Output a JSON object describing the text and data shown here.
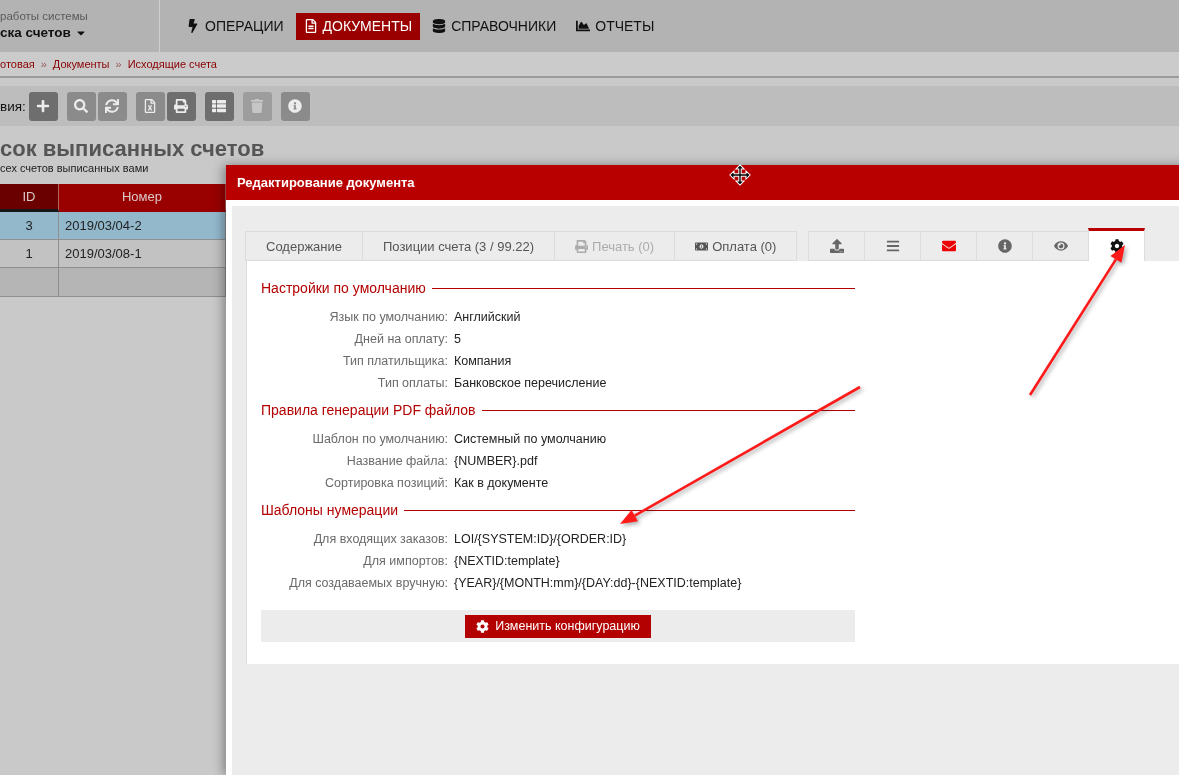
{
  "header": {
    "caption": "работы системы",
    "account": "ска счетов",
    "nav": [
      {
        "label": "ОПЕРАЦИИ",
        "kind": "operations",
        "selected": false
      },
      {
        "label": "ДОКУМЕНТЫ",
        "kind": "documents",
        "selected": true
      },
      {
        "label": "СПРАВОЧНИКИ",
        "kind": "directories",
        "selected": false
      },
      {
        "label": "ОТЧЕТЫ",
        "kind": "reports",
        "selected": false
      }
    ]
  },
  "breadcrumbs": {
    "separator": "»",
    "items": [
      "отовая",
      "Документы",
      "Исходящие счета"
    ]
  },
  "toolbar": {
    "label": "вия:",
    "groups": [
      [
        {
          "kind": "add",
          "disabled": false
        }
      ],
      [
        {
          "kind": "search",
          "disabled": false
        },
        {
          "kind": "refresh",
          "disabled": false
        }
      ],
      [
        {
          "kind": "excel",
          "disabled": false
        },
        {
          "kind": "print",
          "disabled": false
        }
      ],
      [
        {
          "kind": "list",
          "disabled": false
        }
      ],
      [
        {
          "kind": "delete",
          "disabled": true
        }
      ],
      [
        {
          "kind": "info",
          "disabled": false
        }
      ]
    ]
  },
  "page": {
    "title": "сок выписанных счетов",
    "subtitle": "сех счетов выписанных вами"
  },
  "table": {
    "columns": [
      {
        "label": "ID",
        "sorted": true
      },
      {
        "label": "Номер",
        "sorted": false
      }
    ],
    "rows": [
      {
        "cells": [
          "3",
          "2019/03/04-2"
        ],
        "selected": true
      },
      {
        "cells": [
          "1",
          "2019/03/08-1"
        ],
        "selected": false
      }
    ]
  },
  "modal": {
    "title": "Редактирование документа",
    "tabs": [
      {
        "label": "Содержание",
        "kind": "plain",
        "selected": false,
        "disabled": false
      },
      {
        "label": "Позиции счета (3 / 99.22)",
        "kind": "plain",
        "selected": false,
        "disabled": false
      },
      {
        "label": "Печать (0)",
        "kind": "print",
        "selected": false,
        "disabled": true
      },
      {
        "label": "Оплата (0)",
        "kind": "payment",
        "selected": false,
        "disabled": false
      }
    ],
    "icon_tabs": [
      {
        "kind": "upload",
        "selected": false,
        "alert": false
      },
      {
        "kind": "list",
        "selected": false,
        "alert": false
      },
      {
        "kind": "mail",
        "selected": false,
        "alert": true
      },
      {
        "kind": "info",
        "selected": false,
        "alert": false
      },
      {
        "kind": "preview",
        "selected": false,
        "alert": false
      },
      {
        "kind": "settings",
        "selected": true,
        "alert": false
      }
    ],
    "sections": [
      {
        "title": "Настройки по умолчанию",
        "rows": [
          {
            "label": "Язык по умолчанию:",
            "value": "Английский"
          },
          {
            "label": "Дней на оплату:",
            "value": "5"
          },
          {
            "label": "Тип платильщика:",
            "value": "Компания"
          },
          {
            "label": "Тип оплаты:",
            "value": "Банковское перечисление"
          }
        ]
      },
      {
        "title": "Правила генерации PDF файлов",
        "rows": [
          {
            "label": "Шаблон по умолчанию:",
            "value": "Системный по умолчанию"
          },
          {
            "label": "Название файла:",
            "value": "{NUMBER}.pdf"
          },
          {
            "label": "Сортировка позиций:",
            "value": "Как в документе"
          }
        ]
      },
      {
        "title": "Шаблоны нумерации",
        "rows": [
          {
            "label": "Для входящих заказов:",
            "value": "LOI/{SYSTEM:ID}/{ORDER:ID}"
          },
          {
            "label": "Для импортов:",
            "value": "{NEXTID:template}"
          },
          {
            "label": "Для создаваемых вручную:",
            "value": "{YEAR}/{MONTH:mm}/{DAY:dd}-{NEXTID:template}"
          }
        ]
      }
    ],
    "button": "Изменить конфигурацию"
  }
}
